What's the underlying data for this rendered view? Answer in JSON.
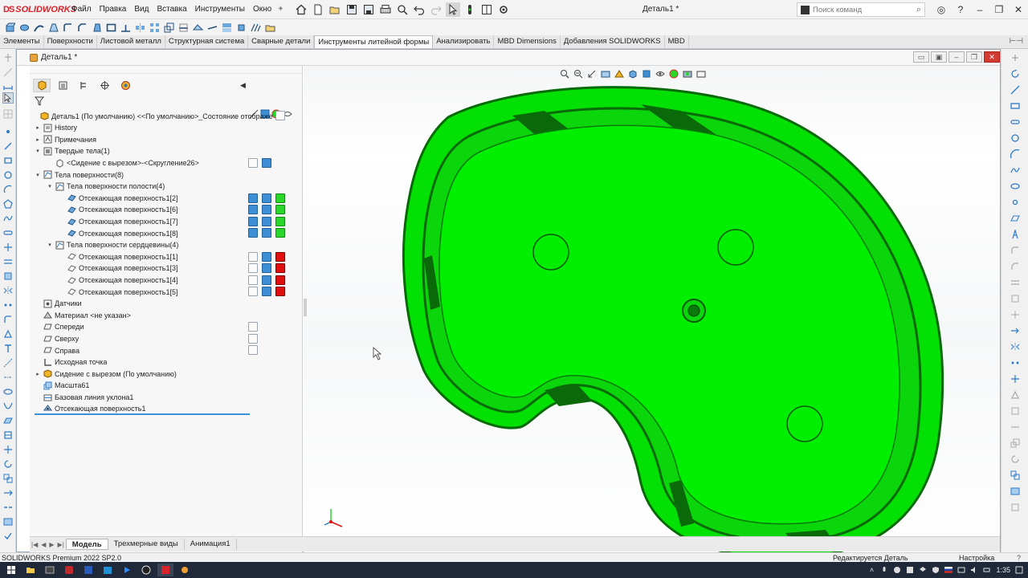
{
  "app": {
    "brand": "SOLIDWORKS",
    "brand_ds": "DS",
    "document_title": "Деталь1 *",
    "menu": [
      "Файл",
      "Правка",
      "Вид",
      "Вставка",
      "Инструменты",
      "Окно"
    ],
    "search_placeholder": "Поиск команд"
  },
  "command_tabs": [
    {
      "label": "Элементы",
      "active": false
    },
    {
      "label": "Поверхности",
      "active": false
    },
    {
      "label": "Листовой металл",
      "active": false
    },
    {
      "label": "Структурная система",
      "active": false
    },
    {
      "label": "Сварные детали",
      "active": false
    },
    {
      "label": "Инструменты литейной формы",
      "active": true
    },
    {
      "label": "Анализировать",
      "active": false
    },
    {
      "label": "MBD Dimensions",
      "active": false
    },
    {
      "label": "Добавления SOLIDWORKS",
      "active": false
    },
    {
      "label": "MBD",
      "active": false
    }
  ],
  "document": {
    "tab_label": "Деталь1 *"
  },
  "feature_tree": {
    "root": "Деталь1 (По умолчанию) <<По умолчанию>_Состояние отображе",
    "nodes": [
      {
        "label": "History",
        "depth": 1,
        "expand": "▸",
        "icon": "history-icon"
      },
      {
        "label": "Примечания",
        "depth": 1,
        "expand": "▸",
        "icon": "annotations-icon"
      },
      {
        "label": "Твердые тела(1)",
        "depth": 1,
        "expand": "▾",
        "icon": "solid-bodies-icon"
      },
      {
        "label": "<Сидение с вырезом>-<Скругление26>",
        "depth": 2,
        "expand": "",
        "icon": "solid-body-icon"
      },
      {
        "label": "Тела поверхности(8)",
        "depth": 1,
        "expand": "▾",
        "icon": "surface-bodies-icon"
      },
      {
        "label": "Тела поверхности полости(4)",
        "depth": 2,
        "expand": "▾",
        "icon": "surface-bodies-icon"
      },
      {
        "label": "Отсекающая поверхность1[2]",
        "depth": 3,
        "expand": "",
        "icon": "surface-body-icon"
      },
      {
        "label": "Отсекающая поверхность1[6]",
        "depth": 3,
        "expand": "",
        "icon": "surface-body-icon"
      },
      {
        "label": "Отсекающая поверхность1[7]",
        "depth": 3,
        "expand": "",
        "icon": "surface-body-icon"
      },
      {
        "label": "Отсекающая поверхность1[8]",
        "depth": 3,
        "expand": "",
        "icon": "surface-body-icon"
      },
      {
        "label": "Тела поверхности сердцевины(4)",
        "depth": 2,
        "expand": "▾",
        "icon": "surface-bodies-icon"
      },
      {
        "label": "Отсекающая поверхность1[1]",
        "depth": 3,
        "expand": "",
        "icon": "surface-body-hidden-icon"
      },
      {
        "label": "Отсекающая поверхность1[3]",
        "depth": 3,
        "expand": "",
        "icon": "surface-body-hidden-icon"
      },
      {
        "label": "Отсекающая поверхность1[4]",
        "depth": 3,
        "expand": "",
        "icon": "surface-body-hidden-icon"
      },
      {
        "label": "Отсекающая поверхность1[5]",
        "depth": 3,
        "expand": "",
        "icon": "surface-body-hidden-icon"
      },
      {
        "label": "Датчики",
        "depth": 1,
        "expand": "",
        "icon": "sensors-icon"
      },
      {
        "label": "Материал <не указан>",
        "depth": 1,
        "expand": "",
        "icon": "material-icon"
      },
      {
        "label": "Спереди",
        "depth": 1,
        "expand": "",
        "icon": "plane-icon"
      },
      {
        "label": "Сверху",
        "depth": 1,
        "expand": "",
        "icon": "plane-icon"
      },
      {
        "label": "Справа",
        "depth": 1,
        "expand": "",
        "icon": "plane-icon"
      },
      {
        "label": "Исходная точка",
        "depth": 1,
        "expand": "",
        "icon": "origin-icon"
      },
      {
        "label": "Сидение с вырезом (По умолчанию)",
        "depth": 1,
        "expand": "▸",
        "icon": "part-icon"
      },
      {
        "label": "Масшта61",
        "depth": 1,
        "expand": "",
        "icon": "scale-icon"
      },
      {
        "label": "Базовая линия уклона1",
        "depth": 1,
        "expand": "",
        "icon": "parting-line-icon"
      },
      {
        "label": "Отсекающая поверхность1",
        "depth": 1,
        "expand": "",
        "icon": "shutoff-surface-icon"
      }
    ]
  },
  "bottom_tabs": [
    {
      "label": "Модель",
      "active": true
    },
    {
      "label": "Трехмерные виды",
      "active": false
    },
    {
      "label": "Анимация1",
      "active": false
    }
  ],
  "status": {
    "version": "SOLIDWORKS Premium 2022 SP2.0",
    "editing": "Редактируется Деталь",
    "custom": "Настройка",
    "help": "?"
  },
  "taskbar": {
    "clock": "1:35"
  },
  "colors": {
    "part_green": "#00f000",
    "part_dark": "#0a7a0a",
    "core_red": "#e01010",
    "cavity_green": "#2bd62b",
    "brand_red": "#d8232a",
    "selection_blue": "#3a8fd6"
  }
}
